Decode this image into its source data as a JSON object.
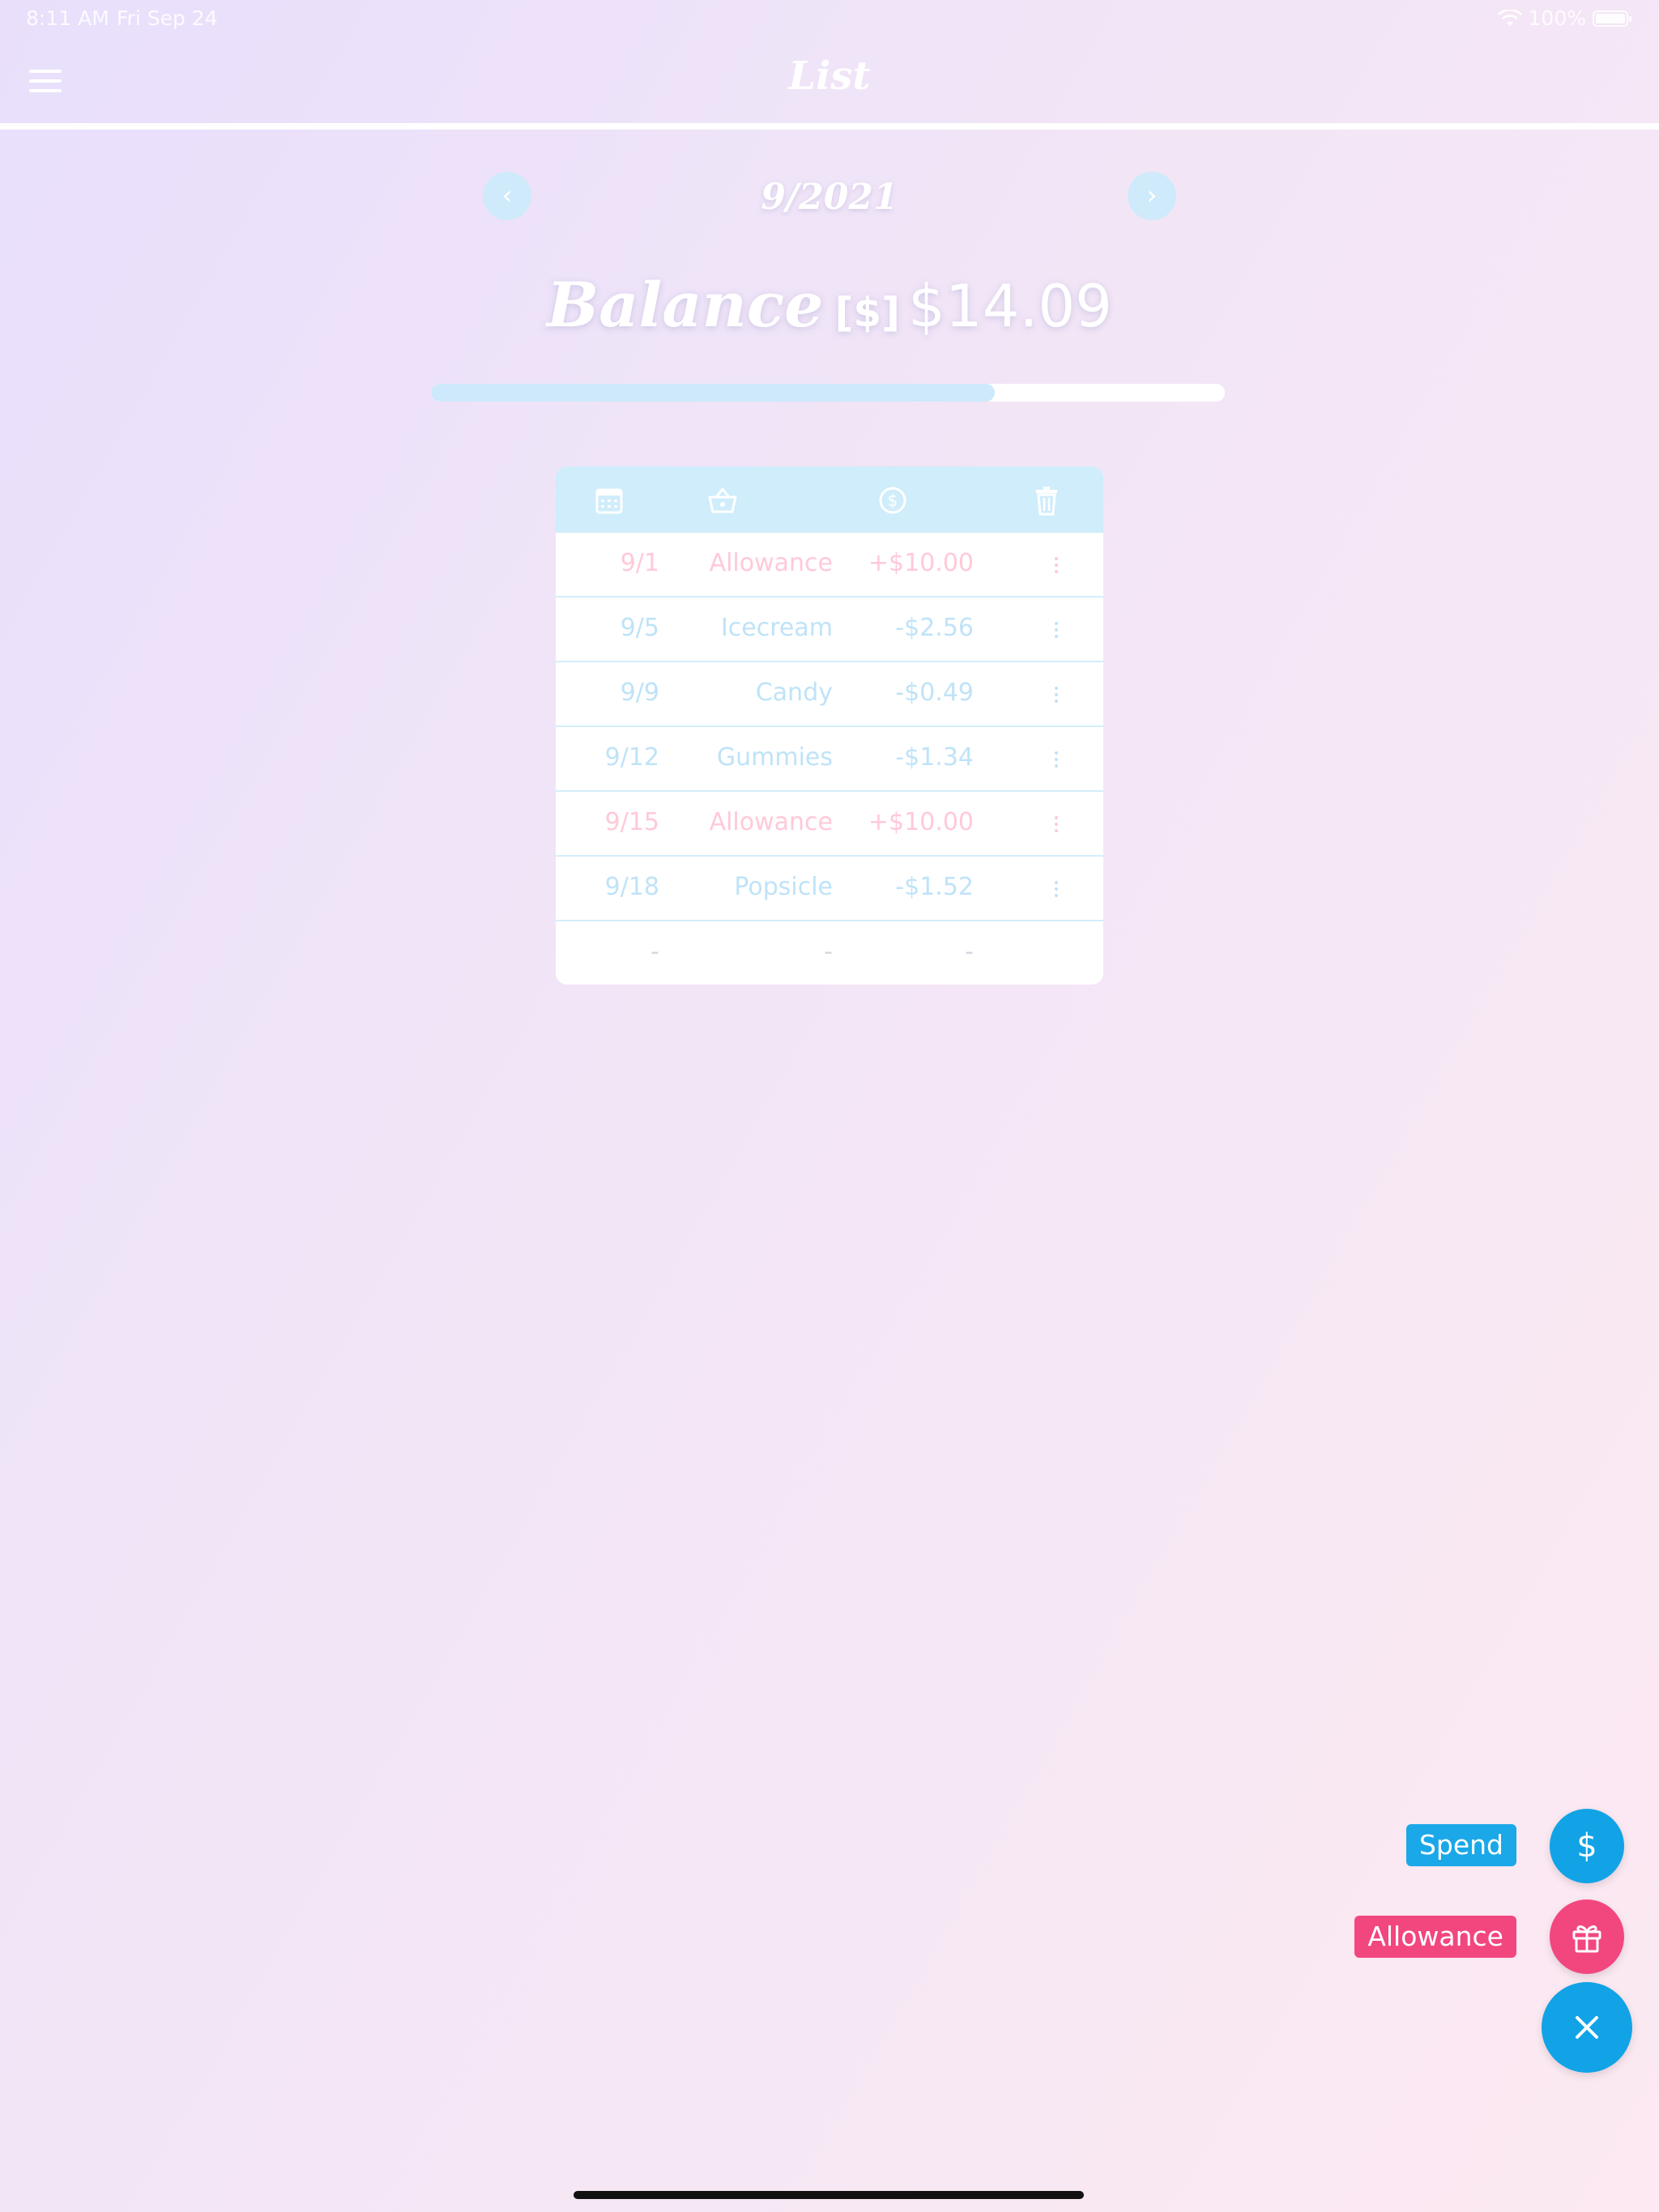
{
  "status_bar": {
    "time": "8:11 AM",
    "date": "Fri Sep 24",
    "battery": "100%"
  },
  "header": {
    "title": "List"
  },
  "month": {
    "label": "9/2021",
    "prev_icon": "‹",
    "next_icon": "›"
  },
  "balance": {
    "label": "Balance",
    "unit": "[$]",
    "amount": "$14.09",
    "progress_fraction": 0.71
  },
  "table": {
    "header_icons": [
      "calendar-icon",
      "basket-icon",
      "dollar-circle-icon",
      "trash-icon"
    ],
    "rows": [
      {
        "date": "9/1",
        "item": "Allowance",
        "amount": "+$10.00",
        "type": "income"
      },
      {
        "date": "9/5",
        "item": "Icecream",
        "amount": "-$2.56",
        "type": "expense"
      },
      {
        "date": "9/9",
        "item": "Candy",
        "amount": "-$0.49",
        "type": "expense"
      },
      {
        "date": "9/12",
        "item": "Gummies",
        "amount": "-$1.34",
        "type": "expense"
      },
      {
        "date": "9/15",
        "item": "Allowance",
        "amount": "+$10.00",
        "type": "income"
      },
      {
        "date": "9/18",
        "item": "Popsicle",
        "amount": "-$1.52",
        "type": "expense"
      },
      {
        "date": "-",
        "item": "-",
        "amount": "-",
        "type": "empty"
      }
    ]
  },
  "fab": {
    "spend_label": "Spend",
    "spend_icon": "$",
    "allowance_label": "Allowance",
    "allowance_icon": "gift-icon",
    "close_icon": "close-icon"
  },
  "colors": {
    "accent_blue": "#12a3e6",
    "accent_pink": "#f2467f",
    "income_text": "#ffc9d8",
    "expense_text": "#bfe3f8"
  }
}
